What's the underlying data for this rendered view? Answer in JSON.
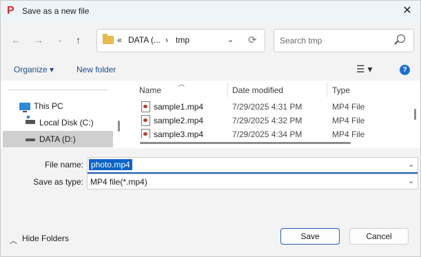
{
  "window": {
    "title": "Save as a new file",
    "app_icon_glyph": "P",
    "app_icon_color": "#d9262c"
  },
  "nav": {
    "breadcrumb_prefix": "«",
    "breadcrumb_parent": "DATA (...",
    "breadcrumb_sep": "›",
    "breadcrumb_current": "tmp",
    "search_placeholder": "Search tmp"
  },
  "toolbar": {
    "organize_label": "Organize ▾",
    "new_folder_label": "New folder"
  },
  "sidebar": {
    "items": [
      {
        "label": "This PC",
        "icon": "computer-icon"
      },
      {
        "label": "Local Disk (C:)",
        "icon": "drive-icon"
      },
      {
        "label": "DATA (D:)",
        "icon": "drive-icon",
        "selected": true
      }
    ]
  },
  "files": {
    "columns": [
      "Name",
      "Date modified",
      "Type"
    ],
    "rows": [
      {
        "name": "sample1.mp4",
        "date": "7/29/2025 4:31 PM",
        "type": "MP4 File"
      },
      {
        "name": "sample2.mp4",
        "date": "7/29/2025 4:32 PM",
        "type": "MP4 File"
      },
      {
        "name": "sample3.mp4",
        "date": "7/29/2025 4:34 PM",
        "type": "MP4 File"
      }
    ]
  },
  "form": {
    "file_name_label": "File name:",
    "file_name_value": "photo.mp4",
    "save_type_label": "Save as type:",
    "save_type_value": "MP4 file(*.mp4)"
  },
  "footer": {
    "hide_folders_label": "Hide Folders",
    "save_label": "Save",
    "cancel_label": "Cancel"
  },
  "colors": {
    "accent": "#1f5fb5",
    "selection": "#0a63c9",
    "link": "#1a4e8a"
  }
}
